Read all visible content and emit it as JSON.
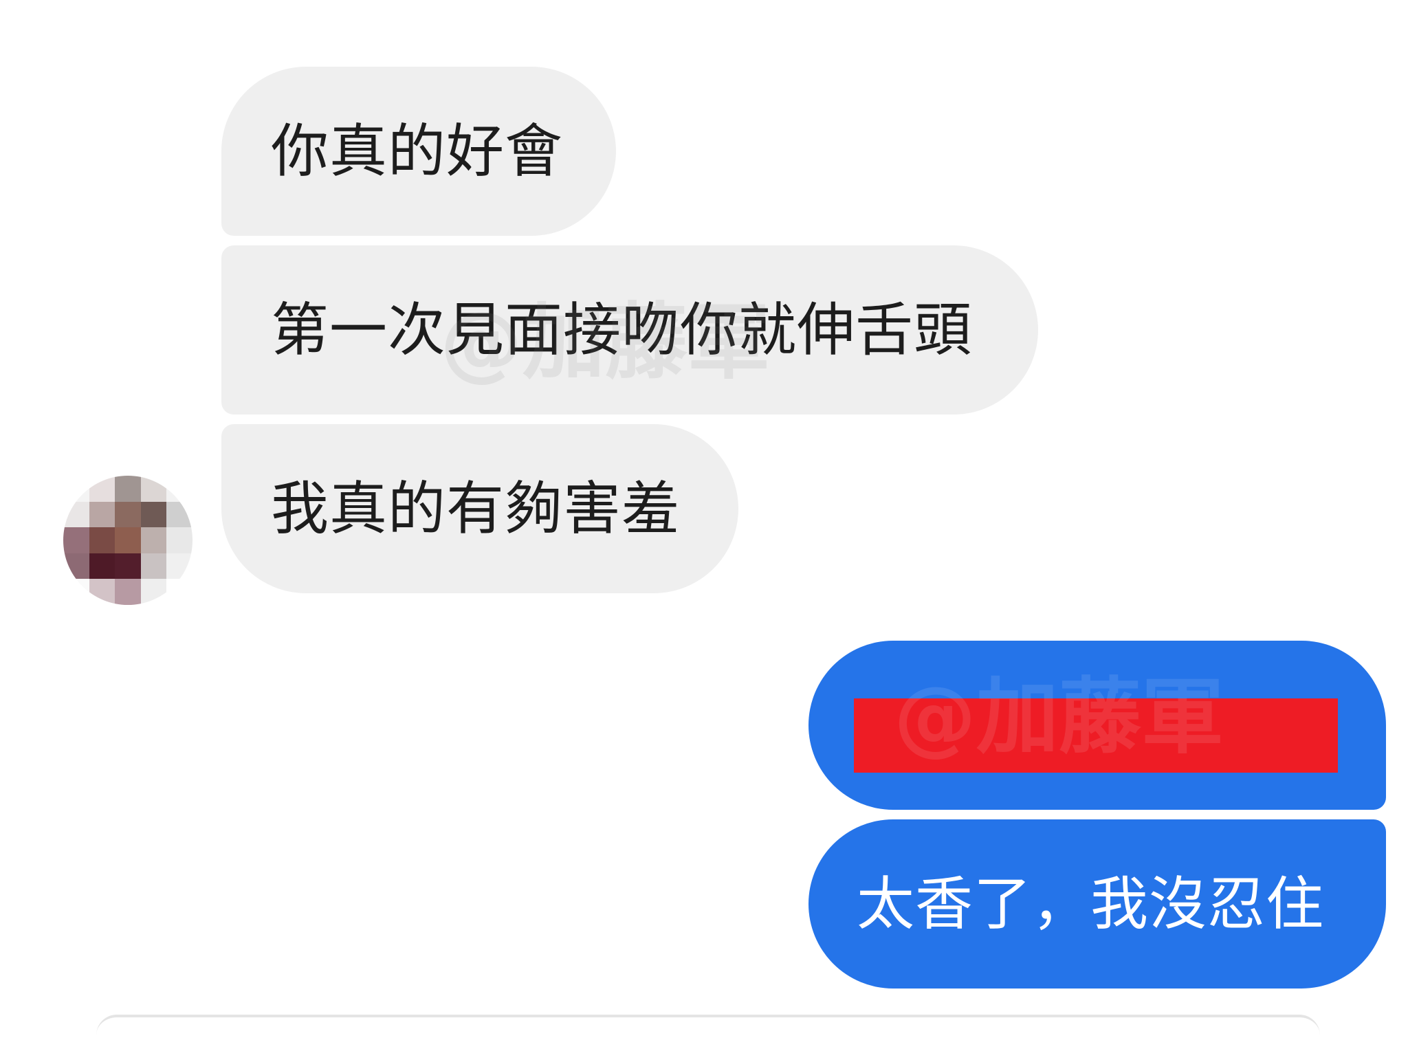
{
  "messages": [
    {
      "side": "incoming",
      "text": "你真的好會"
    },
    {
      "side": "incoming",
      "text": "第一次見面接吻你就伸舌頭"
    },
    {
      "side": "incoming",
      "text": "我真的有夠害羞"
    },
    {
      "side": "outgoing",
      "text": "",
      "redacted": true
    },
    {
      "side": "outgoing",
      "text": "太香了，我沒忍住"
    }
  ],
  "watermark": "@加藤軍",
  "colors": {
    "incoming_bubble": "#efefef",
    "outgoing_bubble": "#2574e9",
    "redaction": "#ee1c25"
  }
}
